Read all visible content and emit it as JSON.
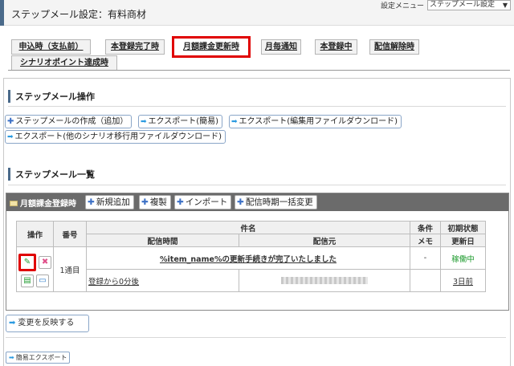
{
  "header": {
    "title": "ステップメール設定：有料商材",
    "menu_label": "設定メニュー",
    "menu_selected": "ステップメール設定"
  },
  "tabs": [
    {
      "label": "申込時（支払前）",
      "active": false
    },
    {
      "label": "本登録完了時",
      "active": false
    },
    {
      "label": "月額課金更新時",
      "active": true
    },
    {
      "label": "月毎通知",
      "active": false
    },
    {
      "label": "本登録中",
      "active": false
    },
    {
      "label": "配信解除時",
      "active": false
    },
    {
      "label": "シナリオポイント達成時",
      "active": false
    }
  ],
  "operations": {
    "title": "ステップメール操作",
    "buttons": [
      {
        "label": "ステップメールの作成（追加）",
        "icon": "plus-icon"
      },
      {
        "label": "エクスポート(簡易)",
        "icon": "arrow-icon"
      },
      {
        "label": "エクスポート(編集用ファイルダウンロード)",
        "icon": "arrow-icon"
      },
      {
        "label": "エクスポート(他のシナリオ移行用ファイルダウンロード)",
        "icon": "arrow-icon"
      }
    ]
  },
  "list": {
    "title": "ステップメール一覧",
    "bar_label": "月額課金登録時",
    "bar_buttons": [
      {
        "label": "新規追加"
      },
      {
        "label": "複製"
      },
      {
        "label": "インポート"
      },
      {
        "label": "配信時期一括変更"
      }
    ],
    "columns": {
      "operation": "操作",
      "number": "番号",
      "subject": "件名",
      "condition": "条件",
      "initial_status": "初期状態",
      "delivery_time": "配信時間",
      "sender": "配信元",
      "memo": "メモ",
      "updated": "更新日"
    },
    "rows": [
      {
        "number": "1通目",
        "subject": "%item_name%の更新手続きが完了いたしました",
        "condition": "-",
        "status": "稼働中",
        "delivery_time": "登録から0分後",
        "sender": "",
        "updated": "3日前"
      }
    ]
  },
  "footer": {
    "reflect_label": "変更を反映する",
    "simple_export_label": "簡易エクスポート"
  },
  "colors": {
    "highlight": "#e00000",
    "status_active": "#1e9b2e",
    "accent": "#4a6a8a"
  }
}
